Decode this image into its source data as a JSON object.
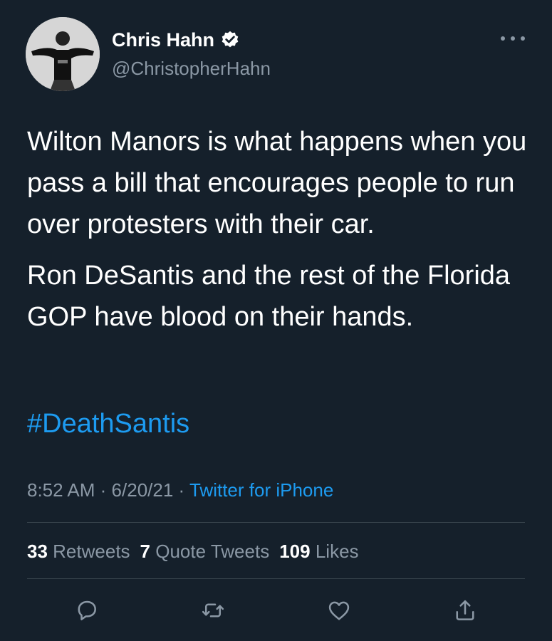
{
  "author": {
    "name": "Chris Hahn",
    "handle": "@ChristopherHahn",
    "avatar_icon": "person-arms-outstretched-avatar",
    "verified_icon": "verified-badge-icon"
  },
  "tweet": {
    "paragraphs": [
      "Wilton Manors is what happens when you pass a bill that encourages people to run over protesters with their car.",
      "Ron DeSantis and the rest of the Florida GOP have blood on their hands."
    ],
    "hashtag": "#DeathSantis"
  },
  "meta": {
    "time": "8:52 AM",
    "separator": "·",
    "date": "6/20/21",
    "source": "Twitter for iPhone"
  },
  "stats": {
    "retweets_count": "33",
    "retweets_label": "Retweets",
    "quotes_count": "7",
    "quotes_label": "Quote Tweets",
    "likes_count": "109",
    "likes_label": "Likes"
  },
  "actions": [
    {
      "icon": "reply-icon"
    },
    {
      "icon": "retweet-icon"
    },
    {
      "icon": "like-heart-icon"
    },
    {
      "icon": "share-icon"
    }
  ],
  "colors": {
    "background": "#15202b",
    "text": "#ffffff",
    "secondary": "#8b98a5",
    "link": "#1d9bf0",
    "divider": "#38444d"
  }
}
